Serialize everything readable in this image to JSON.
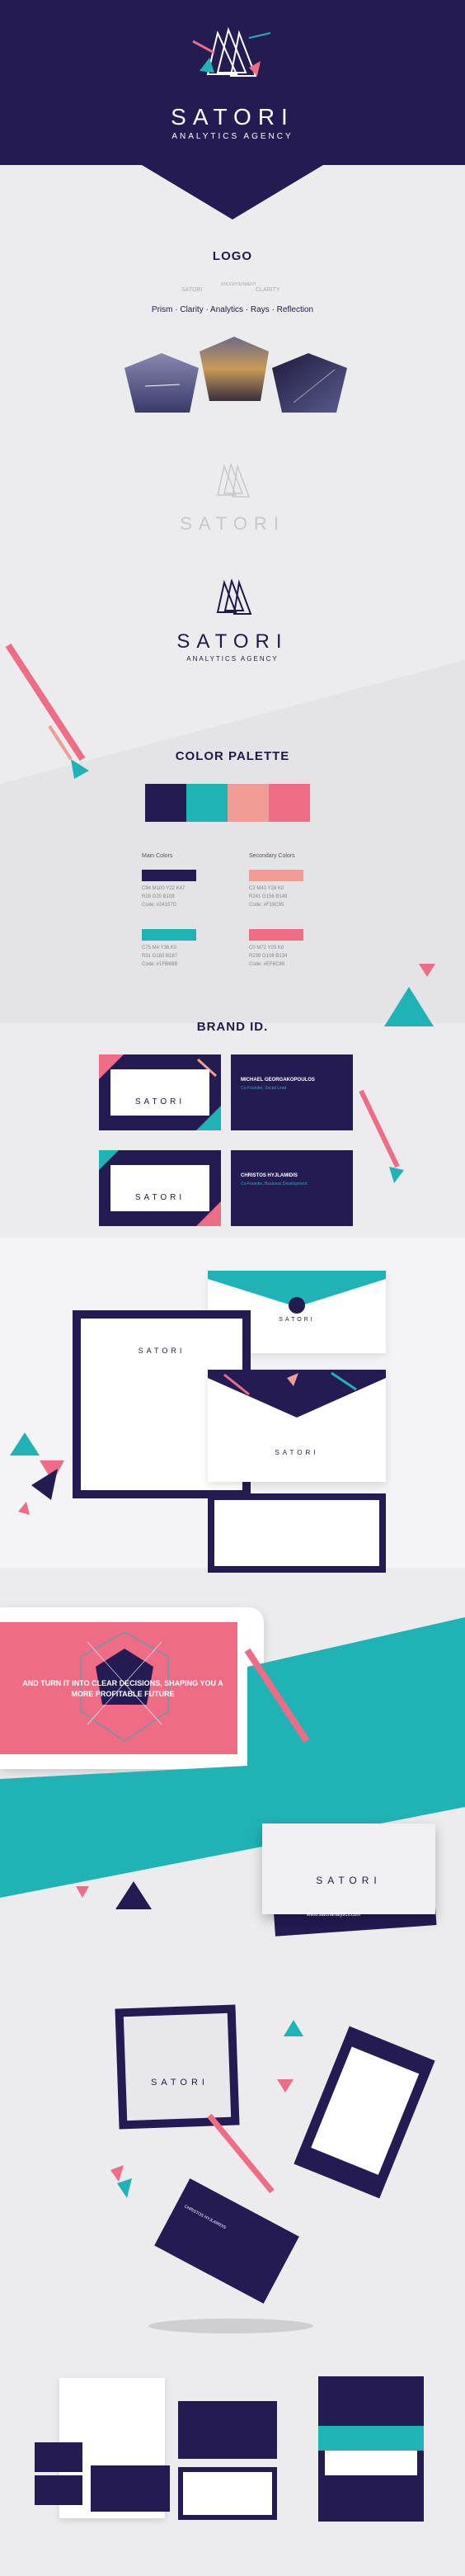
{
  "header": {
    "brand": "SATORI",
    "tagline": "ANALYTICS AGENCY"
  },
  "logo_section": {
    "heading": "LOGO",
    "concept_left": "SATORI",
    "concept_mid": "ENLIGHTENMENT",
    "concept_right": "CLARITY",
    "keywords": "Prism · Clarity · Analytics · Rays · Reflection",
    "wordmark": "SATORI",
    "tagline": "ANALYTICS AGENCY"
  },
  "palette": {
    "heading": "COLOR PALETTE",
    "main_label": "Main Colors",
    "secondary_label": "Secondary Colors",
    "swatches": [
      {
        "name": "navy",
        "hex": "#241b52"
      },
      {
        "name": "teal",
        "hex": "#1fb3b6"
      },
      {
        "name": "peach",
        "hex": "#f19c95"
      },
      {
        "name": "pink",
        "hex": "#ef6c86"
      }
    ],
    "main": [
      {
        "line1": "C94 M100 Y22 K47",
        "line2": "R28 G20 B108",
        "line3": "Code: #24157D"
      },
      {
        "line1": "C75 M4 Y36 K0",
        "line2": "R31 G182 B187",
        "line3": "Code: #1FB6BB"
      }
    ],
    "secondary": [
      {
        "line1": "C2 M43 Y28 K0",
        "line2": "R241 G156 B149",
        "line3": "Code: #F19C95"
      },
      {
        "line1": "C0 M72 Y25 K0",
        "line2": "R239 G108 B134",
        "line3": "Code: #EF6C86"
      }
    ]
  },
  "brand_id": {
    "heading": "BRAND ID.",
    "card1_name": "MICHAEL GEORGAKOPOULOS",
    "card1_title": "Co-Founder, Social Lead",
    "card2_name": "CHRISTOS HYJLAMIDIS",
    "card2_title": "Co-Founder, Business Development"
  },
  "tablet": {
    "headline": "AND TURN IT INTO CLEAR DECISIONS, SHAPING YOU A MORE PROFITABLE FUTURE"
  },
  "web": {
    "url": "www.satorianalytics.com"
  }
}
